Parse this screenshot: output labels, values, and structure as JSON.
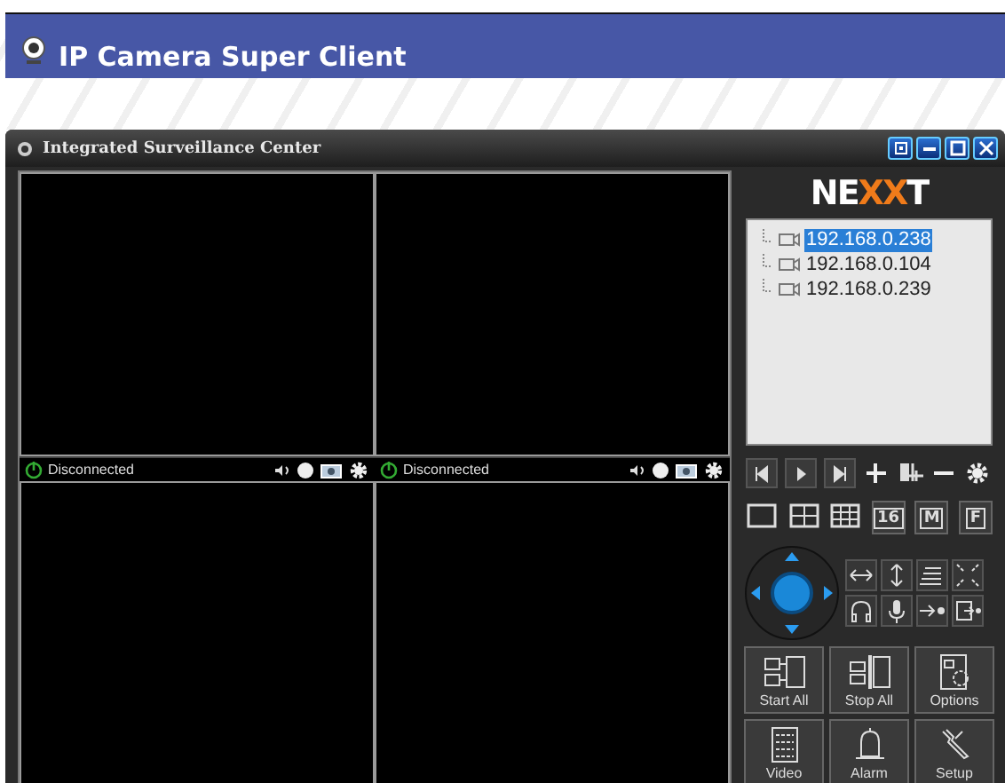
{
  "app": {
    "title": "IP Camera Super Client"
  },
  "window": {
    "title": "Integrated Surveillance Center"
  },
  "video_cells": [
    {
      "kind": "status",
      "status": "Disconnected",
      "connected": false
    },
    {
      "kind": "status",
      "status": "Disconnected",
      "connected": false
    },
    {
      "kind": "plain"
    },
    {
      "kind": "plain"
    }
  ],
  "logo": "NEXXT",
  "devices": [
    {
      "label": "192.168.0.238",
      "selected": true
    },
    {
      "label": "192.168.0.104",
      "selected": false
    },
    {
      "label": "192.168.0.239",
      "selected": false
    }
  ],
  "layout_buttons": [
    {
      "kind": "single"
    },
    {
      "kind": "quad"
    },
    {
      "kind": "nine"
    },
    {
      "kind": "text",
      "label": "16"
    },
    {
      "kind": "text",
      "label": "M"
    },
    {
      "kind": "text",
      "label": "F"
    }
  ],
  "action_buttons": [
    {
      "kind": "start",
      "label": "Start All"
    },
    {
      "kind": "stop",
      "label": "Stop All"
    },
    {
      "kind": "options",
      "label": "Options"
    },
    {
      "kind": "video",
      "label": "Video"
    },
    {
      "kind": "alarm",
      "label": "Alarm"
    },
    {
      "kind": "setup",
      "label": "Setup"
    }
  ]
}
